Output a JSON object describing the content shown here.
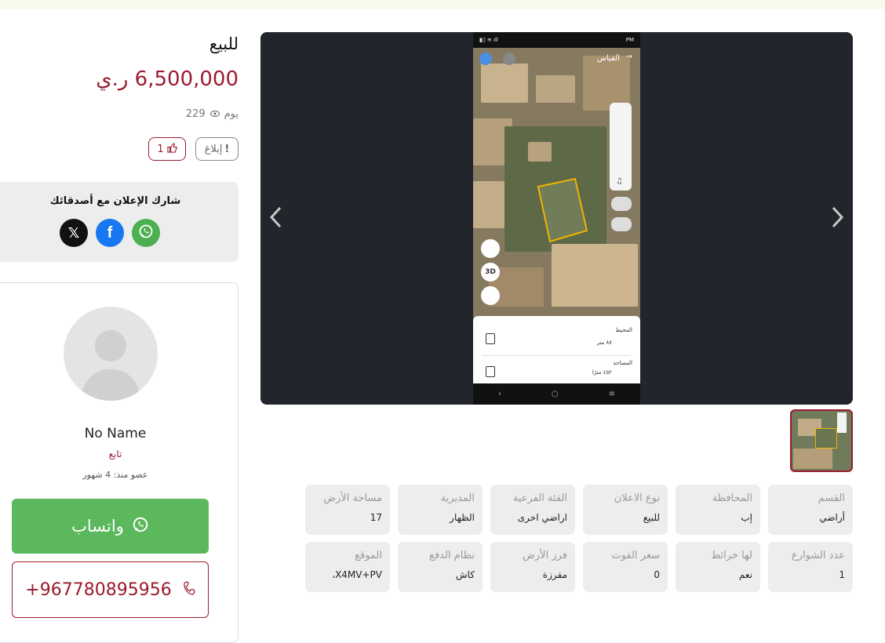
{
  "listing": {
    "type_title": "للبيع",
    "price": "6,500,000 ر.ي",
    "views_count": "229",
    "views_unit": "يوم",
    "likes": "1",
    "report_label": "إبلاغ"
  },
  "share": {
    "title": "شارك الإعلان مع أصدقائك",
    "twitter_glyph": "𝕏",
    "facebook_glyph": "f"
  },
  "seller": {
    "name": "No Name",
    "role": "تابع",
    "member_since": "عضو منذ: 4 شهور",
    "whatsapp_label": "واتساب",
    "phone": "+967780895956"
  },
  "screenshot": {
    "status_time": "PM",
    "measure_label": "القياس",
    "btn_3d": "3D",
    "perimeter_label": "المحيط",
    "perimeter_value": "٨٧ متر",
    "area_label": "المساحة",
    "area_value": "٤٥٢ مترًا"
  },
  "details": [
    {
      "label": "القسم",
      "value": "أراضي"
    },
    {
      "label": "المحافظة",
      "value": "إب"
    },
    {
      "label": "نوع الاعلان",
      "value": "للبيع"
    },
    {
      "label": "الفئة الفرعية",
      "value": "اراضي اخرى"
    },
    {
      "label": "المديرية",
      "value": "الظهار"
    },
    {
      "label": "مساحة الأرض",
      "value": "17"
    },
    {
      "label": "عدد الشوارع",
      "value": "1"
    },
    {
      "label": "لها خرائط",
      "value": "نعم"
    },
    {
      "label": "سعر الفوت",
      "value": "0"
    },
    {
      "label": "فرز الأرض",
      "value": "مفرزة"
    },
    {
      "label": "نظام الدفع",
      "value": "كاش"
    },
    {
      "label": "الموقع",
      "value": "X4MV+PV،"
    }
  ],
  "colors": {
    "brand": "#9b1b2e",
    "whatsapp": "#5cb85c",
    "facebook": "#1877f2",
    "twitter": "#000000"
  },
  "icons": {
    "views": "eye-icon",
    "like": "thumbs-up-icon",
    "report": "exclamation-icon",
    "whatsapp": "whatsapp-icon",
    "phone": "phone-icon",
    "gallery_prev": "chevron-left-icon",
    "gallery_next": "chevron-right-icon"
  }
}
